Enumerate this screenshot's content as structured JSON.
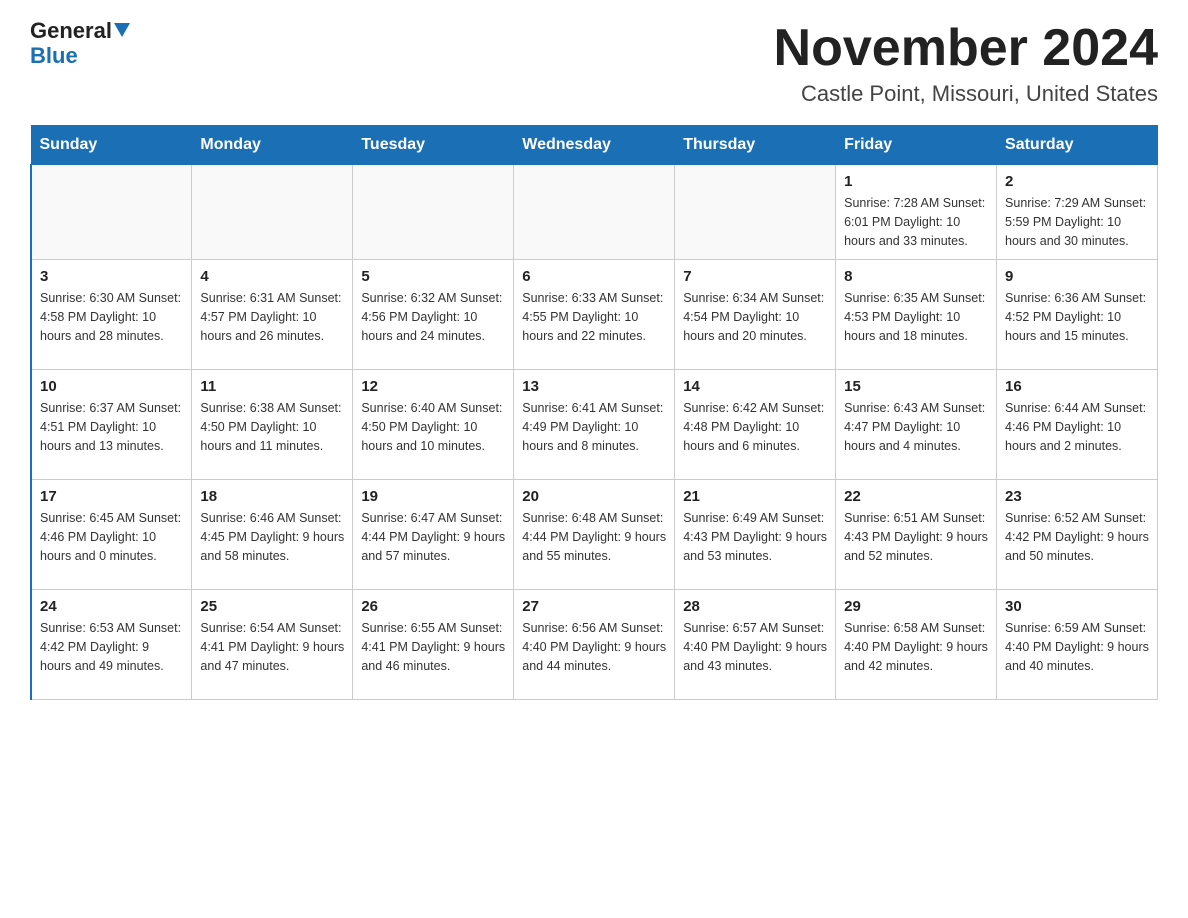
{
  "logo": {
    "general": "General",
    "blue": "Blue"
  },
  "title": "November 2024",
  "subtitle": "Castle Point, Missouri, United States",
  "days_of_week": [
    "Sunday",
    "Monday",
    "Tuesday",
    "Wednesday",
    "Thursday",
    "Friday",
    "Saturday"
  ],
  "weeks": [
    [
      {
        "day": "",
        "info": ""
      },
      {
        "day": "",
        "info": ""
      },
      {
        "day": "",
        "info": ""
      },
      {
        "day": "",
        "info": ""
      },
      {
        "day": "",
        "info": ""
      },
      {
        "day": "1",
        "info": "Sunrise: 7:28 AM\nSunset: 6:01 PM\nDaylight: 10 hours\nand 33 minutes."
      },
      {
        "day": "2",
        "info": "Sunrise: 7:29 AM\nSunset: 5:59 PM\nDaylight: 10 hours\nand 30 minutes."
      }
    ],
    [
      {
        "day": "3",
        "info": "Sunrise: 6:30 AM\nSunset: 4:58 PM\nDaylight: 10 hours\nand 28 minutes."
      },
      {
        "day": "4",
        "info": "Sunrise: 6:31 AM\nSunset: 4:57 PM\nDaylight: 10 hours\nand 26 minutes."
      },
      {
        "day": "5",
        "info": "Sunrise: 6:32 AM\nSunset: 4:56 PM\nDaylight: 10 hours\nand 24 minutes."
      },
      {
        "day": "6",
        "info": "Sunrise: 6:33 AM\nSunset: 4:55 PM\nDaylight: 10 hours\nand 22 minutes."
      },
      {
        "day": "7",
        "info": "Sunrise: 6:34 AM\nSunset: 4:54 PM\nDaylight: 10 hours\nand 20 minutes."
      },
      {
        "day": "8",
        "info": "Sunrise: 6:35 AM\nSunset: 4:53 PM\nDaylight: 10 hours\nand 18 minutes."
      },
      {
        "day": "9",
        "info": "Sunrise: 6:36 AM\nSunset: 4:52 PM\nDaylight: 10 hours\nand 15 minutes."
      }
    ],
    [
      {
        "day": "10",
        "info": "Sunrise: 6:37 AM\nSunset: 4:51 PM\nDaylight: 10 hours\nand 13 minutes."
      },
      {
        "day": "11",
        "info": "Sunrise: 6:38 AM\nSunset: 4:50 PM\nDaylight: 10 hours\nand 11 minutes."
      },
      {
        "day": "12",
        "info": "Sunrise: 6:40 AM\nSunset: 4:50 PM\nDaylight: 10 hours\nand 10 minutes."
      },
      {
        "day": "13",
        "info": "Sunrise: 6:41 AM\nSunset: 4:49 PM\nDaylight: 10 hours\nand 8 minutes."
      },
      {
        "day": "14",
        "info": "Sunrise: 6:42 AM\nSunset: 4:48 PM\nDaylight: 10 hours\nand 6 minutes."
      },
      {
        "day": "15",
        "info": "Sunrise: 6:43 AM\nSunset: 4:47 PM\nDaylight: 10 hours\nand 4 minutes."
      },
      {
        "day": "16",
        "info": "Sunrise: 6:44 AM\nSunset: 4:46 PM\nDaylight: 10 hours\nand 2 minutes."
      }
    ],
    [
      {
        "day": "17",
        "info": "Sunrise: 6:45 AM\nSunset: 4:46 PM\nDaylight: 10 hours\nand 0 minutes."
      },
      {
        "day": "18",
        "info": "Sunrise: 6:46 AM\nSunset: 4:45 PM\nDaylight: 9 hours\nand 58 minutes."
      },
      {
        "day": "19",
        "info": "Sunrise: 6:47 AM\nSunset: 4:44 PM\nDaylight: 9 hours\nand 57 minutes."
      },
      {
        "day": "20",
        "info": "Sunrise: 6:48 AM\nSunset: 4:44 PM\nDaylight: 9 hours\nand 55 minutes."
      },
      {
        "day": "21",
        "info": "Sunrise: 6:49 AM\nSunset: 4:43 PM\nDaylight: 9 hours\nand 53 minutes."
      },
      {
        "day": "22",
        "info": "Sunrise: 6:51 AM\nSunset: 4:43 PM\nDaylight: 9 hours\nand 52 minutes."
      },
      {
        "day": "23",
        "info": "Sunrise: 6:52 AM\nSunset: 4:42 PM\nDaylight: 9 hours\nand 50 minutes."
      }
    ],
    [
      {
        "day": "24",
        "info": "Sunrise: 6:53 AM\nSunset: 4:42 PM\nDaylight: 9 hours\nand 49 minutes."
      },
      {
        "day": "25",
        "info": "Sunrise: 6:54 AM\nSunset: 4:41 PM\nDaylight: 9 hours\nand 47 minutes."
      },
      {
        "day": "26",
        "info": "Sunrise: 6:55 AM\nSunset: 4:41 PM\nDaylight: 9 hours\nand 46 minutes."
      },
      {
        "day": "27",
        "info": "Sunrise: 6:56 AM\nSunset: 4:40 PM\nDaylight: 9 hours\nand 44 minutes."
      },
      {
        "day": "28",
        "info": "Sunrise: 6:57 AM\nSunset: 4:40 PM\nDaylight: 9 hours\nand 43 minutes."
      },
      {
        "day": "29",
        "info": "Sunrise: 6:58 AM\nSunset: 4:40 PM\nDaylight: 9 hours\nand 42 minutes."
      },
      {
        "day": "30",
        "info": "Sunrise: 6:59 AM\nSunset: 4:40 PM\nDaylight: 9 hours\nand 40 minutes."
      }
    ]
  ]
}
